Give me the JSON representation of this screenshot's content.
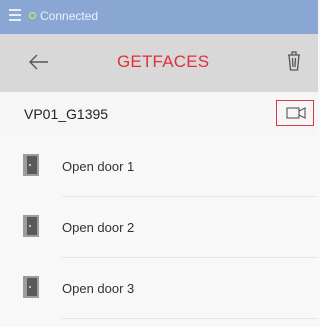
{
  "status": {
    "text": "Connected",
    "menu_icon": "menu-icon",
    "indicator_color": "#c8ff4a",
    "bar_color": "#8aa7d4"
  },
  "header": {
    "title": "GETFACES",
    "back_icon": "arrow-left-icon",
    "delete_icon": "trash-icon",
    "title_color": "#e0313a"
  },
  "device": {
    "label": "VP01_G1395",
    "camera_icon": "video-camera-icon",
    "highlight_color": "#d93b3b"
  },
  "doors": [
    {
      "label": "Open door 1",
      "icon": "door-icon"
    },
    {
      "label": "Open door 2",
      "icon": "door-icon"
    },
    {
      "label": "Open door 3",
      "icon": "door-icon"
    }
  ]
}
